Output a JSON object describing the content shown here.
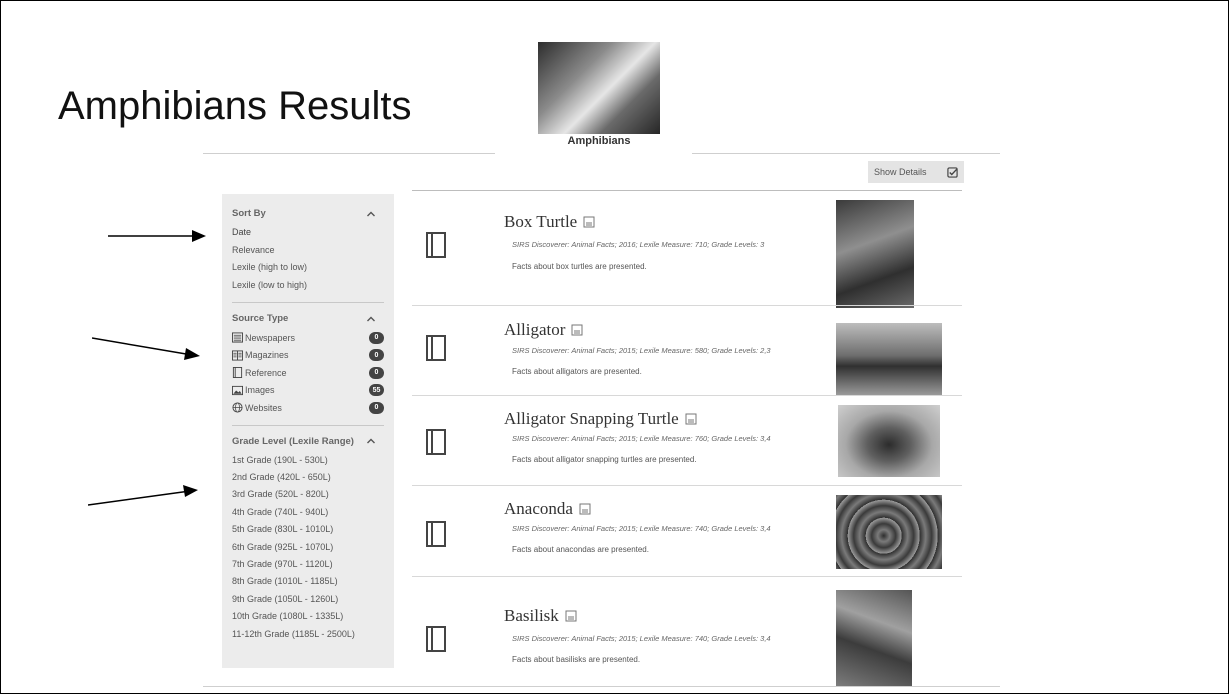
{
  "slide": {
    "title": "Amphibians Results"
  },
  "topic": {
    "label": "Amphibians"
  },
  "toolbar": {
    "show_details": "Show Details"
  },
  "sidebar": {
    "sort": {
      "title": "Sort By",
      "options": [
        "Date",
        "Relevance",
        "Lexile (high to low)",
        "Lexile (low to high)"
      ]
    },
    "source": {
      "title": "Source Type",
      "items": [
        {
          "label": "Newspapers",
          "count": "0"
        },
        {
          "label": "Magazines",
          "count": "0"
        },
        {
          "label": "Reference",
          "count": "0"
        },
        {
          "label": "Images",
          "count": "55"
        },
        {
          "label": "Websites",
          "count": "0"
        }
      ]
    },
    "grade": {
      "title": "Grade Level (Lexile Range)",
      "options": [
        "1st Grade (190L - 530L)",
        "2nd Grade (420L - 650L)",
        "3rd Grade (520L - 820L)",
        "4th Grade (740L - 940L)",
        "5th Grade (830L - 1010L)",
        "6th Grade (925L - 1070L)",
        "7th Grade (970L - 1120L)",
        "8th Grade (1010L - 1185L)",
        "9th Grade (1050L - 1260L)",
        "10th Grade (1080L - 1335L)",
        "11-12th Grade (1185L - 2500L)"
      ]
    }
  },
  "results": [
    {
      "title": "Box Turtle",
      "meta": "SIRS Discoverer: Animal Facts; 2016; Lexile Measure: 710; Grade Levels: 3",
      "desc": "Facts about box turtles are presented."
    },
    {
      "title": "Alligator",
      "meta": "SIRS Discoverer: Animal Facts; 2015; Lexile Measure: 580; Grade Levels: 2,3",
      "desc": "Facts about alligators are presented."
    },
    {
      "title": "Alligator Snapping Turtle",
      "meta": "SIRS Discoverer: Animal Facts; 2015; Lexile Measure: 760; Grade Levels: 3,4",
      "desc": "Facts about alligator snapping turtles are presented."
    },
    {
      "title": "Anaconda",
      "meta": "SIRS Discoverer: Animal Facts; 2015; Lexile Measure: 740; Grade Levels: 3,4",
      "desc": "Facts about anacondas are presented."
    },
    {
      "title": "Basilisk",
      "meta": "SIRS Discoverer: Animal Facts; 2015; Lexile Measure: 740; Grade Levels: 3,4",
      "desc": "Facts about basilisks are presented."
    }
  ]
}
